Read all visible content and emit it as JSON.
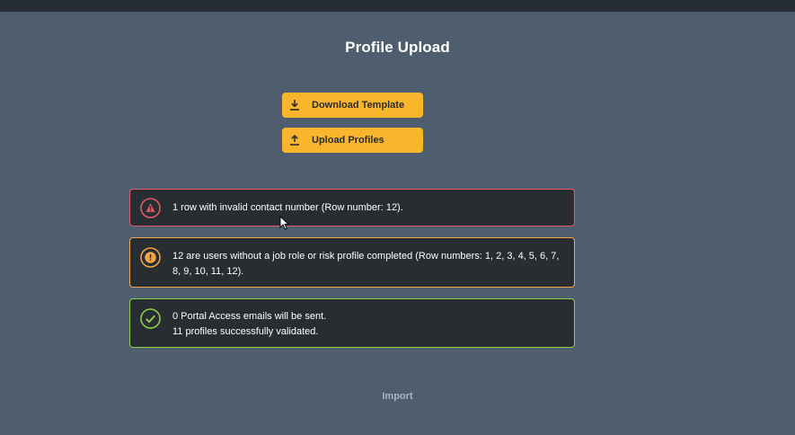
{
  "page": {
    "title": "Profile Upload"
  },
  "actions": {
    "download_label": "Download Template",
    "download_icon": "download-icon",
    "upload_label": "Upload Profiles",
    "upload_icon": "upload-icon",
    "import_label": "Import"
  },
  "alerts": {
    "error": {
      "icon": "warning-triangle-icon",
      "color": "#e35b6b",
      "lines": [
        "1 row with invalid contact number (Row number: 12)."
      ]
    },
    "warning": {
      "icon": "exclamation-circle-icon",
      "color": "#f2a54a",
      "lines": [
        "12 are users without a job role or risk profile completed (Row numbers: 1, 2, 3, 4, 5, 6, 7, 8, 9, 10, 11, 12)."
      ]
    },
    "success": {
      "icon": "check-circle-icon",
      "color": "#8fd14a",
      "lines": [
        "0 Portal Access emails will be sent.",
        "11 profiles successfully validated."
      ]
    }
  },
  "colors": {
    "background": "#4e5e6f",
    "button": "#f9b52b",
    "alert_background": "#282d32"
  }
}
